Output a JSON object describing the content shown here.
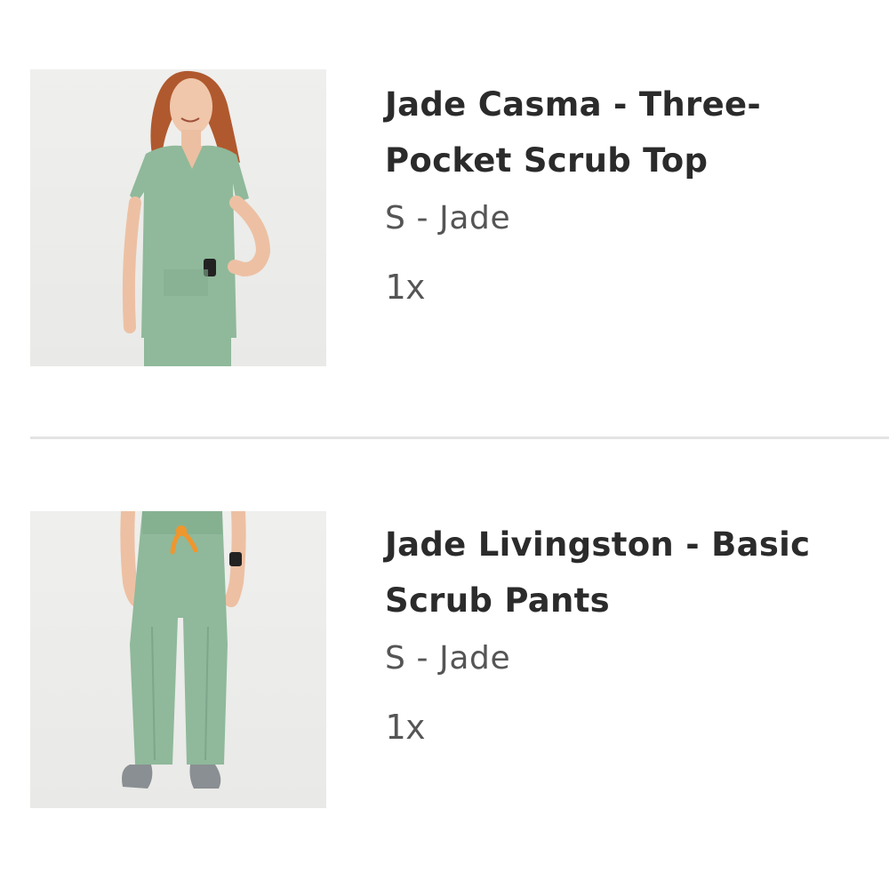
{
  "cart": {
    "items": [
      {
        "title": "Jade Casma - Three-Pocket Scrub Top",
        "variant": "S - Jade",
        "quantity": "1x",
        "image_icon": "scrub-top-product-photo"
      },
      {
        "title": "Jade Livingston - Basic Scrub Pants",
        "variant": "S - Jade",
        "quantity": "1x",
        "image_icon": "scrub-pants-product-photo"
      }
    ]
  },
  "colors": {
    "scrub_jade": "#8fb99a",
    "drawstring": "#f0962e",
    "title_text": "#2b2b2b",
    "secondary_text": "#555555",
    "divider": "#e3e3e3"
  }
}
